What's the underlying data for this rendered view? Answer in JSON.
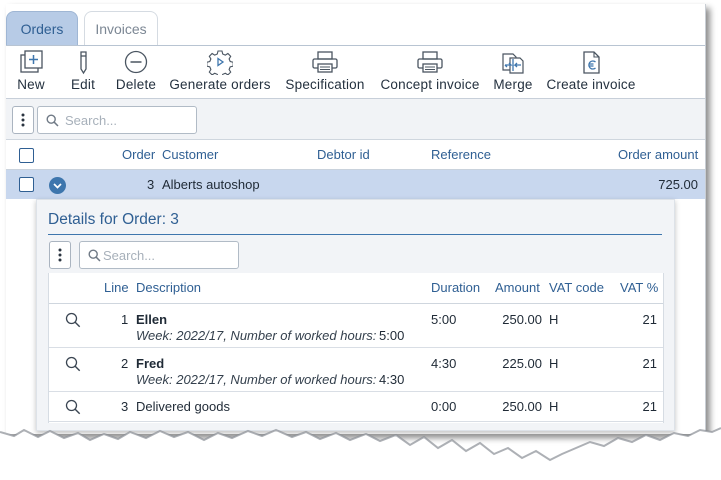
{
  "tabs": [
    {
      "label": "Orders",
      "active": true
    },
    {
      "label": "Invoices",
      "active": false
    }
  ],
  "toolbar": {
    "new": "New",
    "edit": "Edit",
    "delete": "Delete",
    "generate_orders": "Generate orders",
    "specification": "Specification",
    "concept_invoice": "Concept invoice",
    "merge": "Merge",
    "create_invoice": "Create invoice"
  },
  "search": {
    "placeholder": "Search..."
  },
  "orders_grid": {
    "columns": {
      "order": "Order",
      "customer": "Customer",
      "debtor_id": "Debtor id",
      "reference": "Reference",
      "order_amount": "Order amount"
    },
    "rows": [
      {
        "order": "3",
        "customer": "Alberts autoshop",
        "debtor_id": "",
        "reference": "",
        "order_amount": "725.00",
        "expanded": true
      }
    ]
  },
  "details": {
    "title": "Details for Order: 3",
    "search_placeholder": "Search...",
    "columns": {
      "line": "Line",
      "description": "Description",
      "duration": "Duration",
      "amount": "Amount",
      "vat_code": "VAT code",
      "vat_pct": "VAT %"
    },
    "lines": [
      {
        "line": "1",
        "name": "Ellen",
        "detail_label": "Week: 2022/17, Number of worked hours:",
        "detail_value": "5:00",
        "duration": "5:00",
        "amount": "250.00",
        "vat_code": "H",
        "vat_pct": "21"
      },
      {
        "line": "2",
        "name": "Fred",
        "detail_label": "Week: 2022/17, Number of worked hours:",
        "detail_value": "4:30",
        "duration": "4:30",
        "amount": "225.00",
        "vat_code": "H",
        "vat_pct": "21"
      },
      {
        "line": "3",
        "name": "Delivered goods",
        "detail_label": "",
        "detail_value": "",
        "duration": "0:00",
        "amount": "250.00",
        "vat_code": "H",
        "vat_pct": "21"
      }
    ]
  },
  "colors": {
    "accent": "#2f5f93",
    "selected_row": "#c8d7ee",
    "active_tab": "#b7cbe6"
  },
  "icons": [
    "add-document-icon",
    "pencil-icon",
    "minus-circle-icon",
    "gear-icon",
    "printer-icon",
    "merge-icon",
    "euro-document-icon",
    "search-icon",
    "kebab-icon",
    "chevron-down-icon"
  ]
}
